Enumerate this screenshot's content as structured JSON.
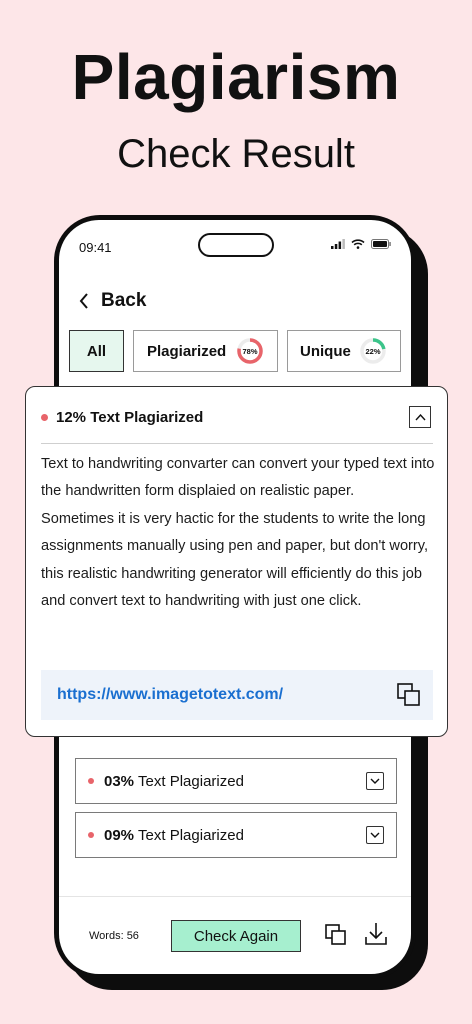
{
  "promo": {
    "headline": "Plagiarism",
    "subheadline": "Check Result"
  },
  "status_bar": {
    "time": "09:41"
  },
  "nav": {
    "back_label": "Back"
  },
  "filters": {
    "all": {
      "label": "All"
    },
    "plagiarized": {
      "label": "Plagiarized",
      "percent_text": "78%",
      "percent": 78,
      "color": "#e8646a"
    },
    "unique": {
      "label": "Unique",
      "percent_text": "22%",
      "percent": 22,
      "color": "#3cc48a"
    }
  },
  "expanded_result": {
    "title": "12% Text Plagiarized",
    "paragraph_1": "Text to handwriting convarter can convert your typed text into the handwritten form displaied on realistic paper.",
    "paragraph_2": "Sometimes it is very hactic for the students to write the long assignments manually using pen and paper, but don't worry, this realistic handwriting generator will efficiently do this job and convert text to handwriting with just one click.",
    "source_url": "https://www.imagetotext.com/"
  },
  "collapsed_results": [
    {
      "percent": "03%",
      "label": "Text Plagiarized"
    },
    {
      "percent": "09%",
      "label": "Text Plagiarized"
    }
  ],
  "footer": {
    "words_label": "Words: 56",
    "check_again_label": "Check Again"
  },
  "colors": {
    "background": "#fde6e8",
    "accent_green": "#a6efcf",
    "link_blue": "#1a6fd0",
    "dot_red": "#e8646a"
  }
}
